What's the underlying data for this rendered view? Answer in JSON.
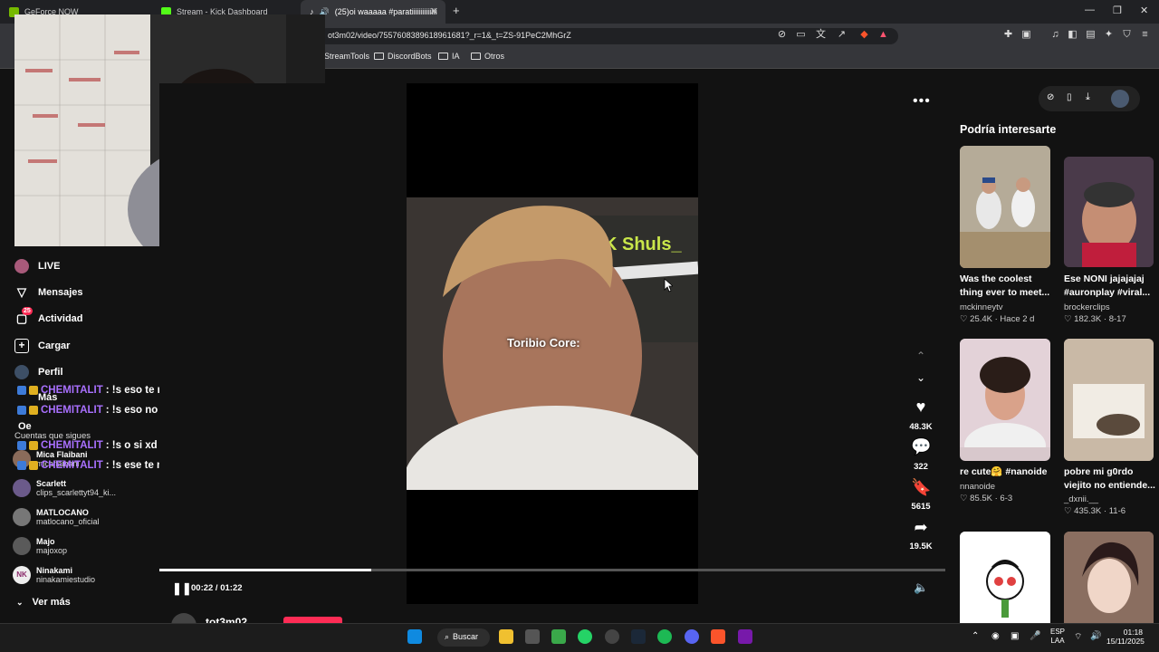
{
  "browser": {
    "tabs": [
      {
        "label": "GeForce NOW"
      },
      {
        "label": "Stream - Kick Dashboard"
      },
      {
        "label": "(25)oi waaaaa #paratiiiiiiiiiiiiii"
      }
    ],
    "url": "ot3m02/video/7557608389618961681?_r=1&_t=ZS-91PeC2MhGrZ",
    "bookmarks": [
      "StreamTools",
      "DiscordBots",
      "IA",
      "Otros"
    ]
  },
  "sidebar": {
    "items": [
      {
        "label": "LIVE",
        "icon": "live-avatar-icon"
      },
      {
        "label": "Mensajes",
        "icon": "send-icon"
      },
      {
        "label": "Actividad",
        "icon": "activity-icon",
        "badge": "25"
      },
      {
        "label": "Cargar",
        "icon": "upload-icon"
      },
      {
        "label": "Perfil",
        "icon": "profile-avatar-icon"
      },
      {
        "label": "Más",
        "icon": "more-icon"
      }
    ],
    "oe_label": "Oe",
    "following_title": "Cuentas que sigues",
    "following": [
      {
        "name": "Mica Flaibani",
        "handle": "micaflaibani"
      },
      {
        "name": "Scarlett",
        "handle": "clips_scarlettyt94_ki..."
      },
      {
        "name": "MATLOCANO",
        "handle": "matlocano_oficial"
      },
      {
        "name": "Majo",
        "handle": "majoxop"
      },
      {
        "name": "Ninakami",
        "handle": "ninakamiestudio"
      }
    ],
    "see_more": "Ver más"
  },
  "chat": [
    {
      "user": "CHEMITALIT",
      "message": ": !s eso te mandé ?"
    },
    {
      "user": "CHEMITALIT",
      "message": ": !s eso no te mandé"
    },
    {
      "user": "CHEMITALIT",
      "message": ": !s o si xd"
    },
    {
      "user": "CHEMITALIT",
      "message": ": !s ese te mandé"
    }
  ],
  "video": {
    "caption_overlay": "Toribio Core:",
    "time": "00:22 / 01:22",
    "progress": 0.27,
    "likes": "48.3K",
    "comments": "322",
    "saves": "5615",
    "shares": "19.5K",
    "author": "tot3m02"
  },
  "recommended": {
    "title": "Podría interesarte",
    "items": [
      {
        "caption": "Was the coolest thing ever to meet...",
        "user": "mckinneytv",
        "stats": "♡ 25.4K · Hace 2 d"
      },
      {
        "caption": "Ese NONI jajajajaj #auronplay #viral...",
        "user": "brockerclips",
        "stats": "♡ 182.3K · 8-17"
      },
      {
        "caption": "re cute🤗 #nanoide",
        "user": "nnanoide",
        "stats": "♡ 85.5K · 6-3"
      },
      {
        "caption": "pobre mi g0rdo viejito no entiende...",
        "user": "_dxnii.__",
        "stats": "♡ 435.3K · 11-6"
      }
    ]
  },
  "taskbar": {
    "search": "Buscar",
    "lang": "ESP",
    "lang2": "LAA",
    "time": "01:18",
    "date": "15/11/2025"
  },
  "colors": {
    "accent": "#fe2c55",
    "chat_user": "#a970ff",
    "bg": "#121212"
  }
}
